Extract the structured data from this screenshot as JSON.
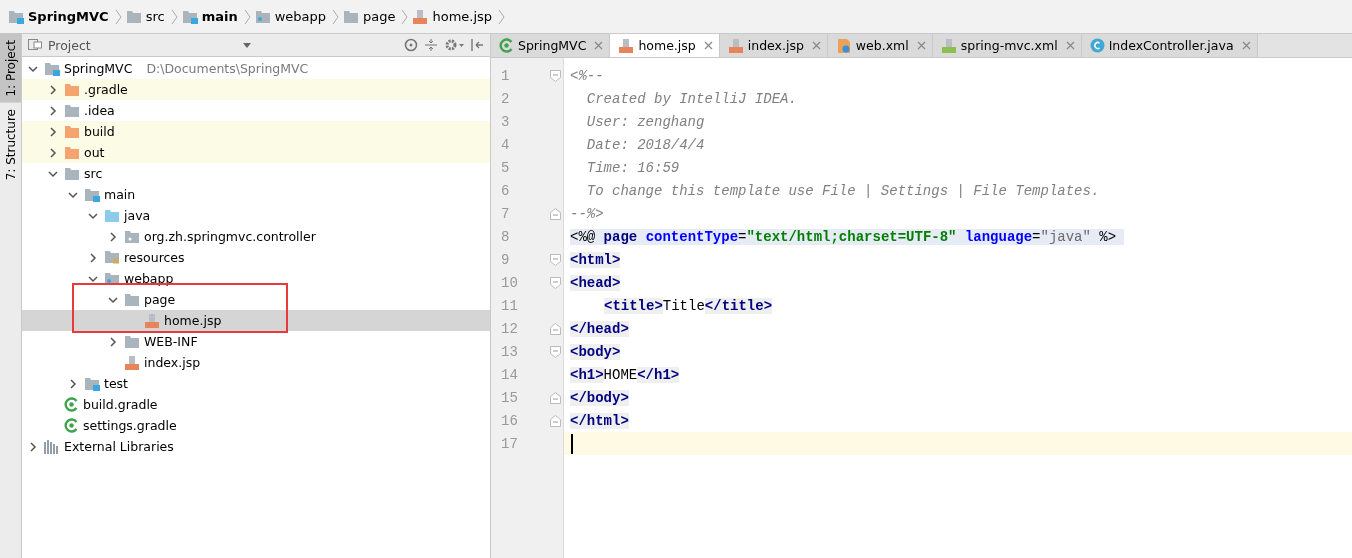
{
  "breadcrumb": [
    {
      "label": "SpringMVC",
      "kind": "module"
    },
    {
      "label": "src",
      "kind": "folder"
    },
    {
      "label": "main",
      "kind": "module"
    },
    {
      "label": "webapp",
      "kind": "web"
    },
    {
      "label": "page",
      "kind": "folder"
    },
    {
      "label": "home.jsp",
      "kind": "jsp"
    }
  ],
  "tool_strip": [
    {
      "label": "1: Project",
      "selected": true
    },
    {
      "label": "7: Structure",
      "selected": false
    }
  ],
  "project_panel": {
    "title": "Project",
    "tree": [
      {
        "label": "SpringMVC",
        "path": "D:\\Documents\\SpringMVC",
        "kind": "module",
        "expanded": true,
        "excluded": false,
        "selected": false,
        "children": [
          {
            "label": ".gradle",
            "kind": "folder",
            "expanded": false,
            "excluded": true,
            "selected": false
          },
          {
            "label": ".idea",
            "kind": "folder",
            "expanded": false,
            "excluded": false,
            "selected": false
          },
          {
            "label": "build",
            "kind": "folder",
            "expanded": false,
            "excluded": true,
            "selected": false
          },
          {
            "label": "out",
            "kind": "folder",
            "expanded": false,
            "excluded": true,
            "selected": false
          },
          {
            "label": "src",
            "kind": "folder",
            "expanded": true,
            "excluded": false,
            "selected": false,
            "children": [
              {
                "label": "main",
                "kind": "module",
                "expanded": true,
                "excluded": false,
                "selected": false,
                "children": [
                  {
                    "label": "java",
                    "kind": "source",
                    "expanded": true,
                    "excluded": false,
                    "selected": false,
                    "children": [
                      {
                        "label": "org.zh.springmvc.controller",
                        "kind": "package",
                        "expanded": false,
                        "excluded": false,
                        "selected": false
                      }
                    ]
                  },
                  {
                    "label": "resources",
                    "kind": "resources",
                    "expanded": false,
                    "excluded": false,
                    "selected": false
                  },
                  {
                    "label": "webapp",
                    "kind": "web",
                    "expanded": true,
                    "excluded": false,
                    "selected": false,
                    "children": [
                      {
                        "label": "page",
                        "kind": "folder",
                        "expanded": true,
                        "excluded": false,
                        "selected": false,
                        "children": [
                          {
                            "label": "home.jsp",
                            "kind": "jsp",
                            "excluded": false,
                            "selected": true
                          }
                        ]
                      },
                      {
                        "label": "WEB-INF",
                        "kind": "folder",
                        "expanded": false,
                        "excluded": false,
                        "selected": false
                      },
                      {
                        "label": "index.jsp",
                        "kind": "jsp",
                        "excluded": false,
                        "selected": false
                      }
                    ]
                  }
                ]
              },
              {
                "label": "test",
                "kind": "module",
                "expanded": false,
                "excluded": false,
                "selected": false
              }
            ]
          },
          {
            "label": "build.gradle",
            "kind": "gradle",
            "excluded": false,
            "selected": false
          },
          {
            "label": "settings.gradle",
            "kind": "gradle",
            "excluded": false,
            "selected": false
          }
        ]
      },
      {
        "label": "External Libraries",
        "kind": "libraries",
        "expanded": false,
        "excluded": false,
        "selected": false
      }
    ]
  },
  "editor": {
    "tabs": [
      {
        "label": "SpringMVC",
        "kind": "gradle",
        "selected": false
      },
      {
        "label": "home.jsp",
        "kind": "jsp",
        "selected": true
      },
      {
        "label": "index.jsp",
        "kind": "jsp",
        "selected": false
      },
      {
        "label": "web.xml",
        "kind": "xml",
        "selected": false
      },
      {
        "label": "spring-mvc.xml",
        "kind": "spring-xml",
        "selected": false
      },
      {
        "label": "IndexController.java",
        "kind": "java-class",
        "selected": false
      }
    ],
    "lines": [
      {
        "number": "1",
        "kind": "fold-start",
        "current": false,
        "highlight": false,
        "segments": [
          {
            "kind": "comment",
            "text": "<%--"
          }
        ]
      },
      {
        "number": "2",
        "kind": "plain",
        "current": false,
        "highlight": false,
        "segments": [
          {
            "kind": "comment",
            "text": "  Created by IntelliJ IDEA."
          }
        ]
      },
      {
        "number": "3",
        "kind": "plain",
        "current": false,
        "highlight": false,
        "segments": [
          {
            "kind": "comment",
            "text": "  User: zenghang"
          }
        ]
      },
      {
        "number": "4",
        "kind": "plain",
        "current": false,
        "highlight": false,
        "segments": [
          {
            "kind": "comment",
            "text": "  Date: 2018/4/4"
          }
        ]
      },
      {
        "number": "5",
        "kind": "plain",
        "current": false,
        "highlight": false,
        "segments": [
          {
            "kind": "comment",
            "text": "  Time: 16:59"
          }
        ]
      },
      {
        "number": "6",
        "kind": "plain",
        "current": false,
        "highlight": false,
        "segments": [
          {
            "kind": "comment",
            "text": "  To change this template use File | Settings | File Templates."
          }
        ]
      },
      {
        "number": "7",
        "kind": "fold-end",
        "current": false,
        "highlight": false,
        "segments": [
          {
            "kind": "comment",
            "text": "--%>"
          }
        ]
      },
      {
        "number": "8",
        "kind": "plain",
        "current": false,
        "highlight": true,
        "segments": [
          {
            "kind": "plain",
            "text": "<%@ "
          },
          {
            "kind": "keyword",
            "text": "page "
          },
          {
            "kind": "attr",
            "text": "contentType"
          },
          {
            "kind": "plain",
            "text": "="
          },
          {
            "kind": "string",
            "text": "\"text/html;charset=UTF-8\" "
          },
          {
            "kind": "attr",
            "text": "language"
          },
          {
            "kind": "plain",
            "text": "="
          },
          {
            "kind": "value",
            "text": "\"java\""
          },
          {
            "kind": "plain",
            "text": " %>"
          }
        ]
      },
      {
        "number": "9",
        "kind": "fold-start",
        "current": false,
        "highlight": false,
        "segments": [
          {
            "kind": "tag",
            "text": "<html>"
          }
        ]
      },
      {
        "number": "10",
        "kind": "fold-start",
        "current": false,
        "highlight": false,
        "segments": [
          {
            "kind": "tag",
            "text": "<head>"
          }
        ]
      },
      {
        "number": "11",
        "kind": "indented",
        "current": false,
        "highlight": false,
        "segments": [
          {
            "kind": "tag",
            "text": "<title>"
          },
          {
            "kind": "text",
            "text": "Title"
          },
          {
            "kind": "tag",
            "text": "</title>"
          }
        ]
      },
      {
        "number": "12",
        "kind": "fold-end",
        "current": false,
        "highlight": false,
        "segments": [
          {
            "kind": "tag",
            "text": "</head>"
          }
        ]
      },
      {
        "number": "13",
        "kind": "fold-start",
        "current": false,
        "highlight": false,
        "segments": [
          {
            "kind": "tag",
            "text": "<body>"
          }
        ]
      },
      {
        "number": "14",
        "kind": "plain",
        "current": false,
        "highlight": false,
        "segments": [
          {
            "kind": "tag",
            "text": "<h1>"
          },
          {
            "kind": "text",
            "text": "HOME"
          },
          {
            "kind": "tag",
            "text": "</h1>"
          }
        ]
      },
      {
        "number": "15",
        "kind": "fold-end",
        "current": false,
        "highlight": false,
        "segments": [
          {
            "kind": "tag",
            "text": "</body>"
          }
        ]
      },
      {
        "number": "16",
        "kind": "fold-end",
        "current": false,
        "highlight": false,
        "segments": [
          {
            "kind": "tag",
            "text": "</html>"
          }
        ]
      },
      {
        "number": "17",
        "kind": "plain",
        "current": true
      }
    ]
  }
}
